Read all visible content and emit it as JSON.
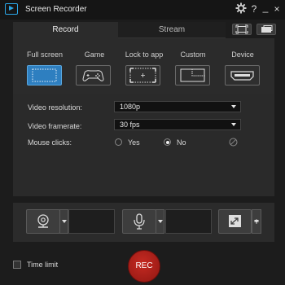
{
  "window": {
    "title": "Screen Recorder",
    "controls": {
      "settings_icon": "gear-icon",
      "help": "?",
      "minimize": "_",
      "close": "×"
    }
  },
  "tabs": [
    {
      "label": "Record",
      "active": true
    },
    {
      "label": "Stream",
      "active": false
    }
  ],
  "capture_modes": [
    {
      "label": "Full screen",
      "active": true
    },
    {
      "label": "Game",
      "active": false
    },
    {
      "label": "Lock to app",
      "active": false
    },
    {
      "label": "Custom",
      "active": false
    },
    {
      "label": "Device",
      "active": false
    }
  ],
  "settings": {
    "resolution_label": "Video resolution:",
    "resolution_value": "1080p",
    "framerate_label": "Video framerate:",
    "framerate_value": "30 fps",
    "mouse_clicks_label": "Mouse clicks:",
    "mouse_yes": "Yes",
    "mouse_no": "No",
    "mouse_selected": "No"
  },
  "bottom": {
    "time_limit_label": "Time limit",
    "rec_label": "REC"
  },
  "colors": {
    "accent": "#2e7fc0",
    "rec": "#b8231c",
    "background": "#1c1c1c"
  }
}
